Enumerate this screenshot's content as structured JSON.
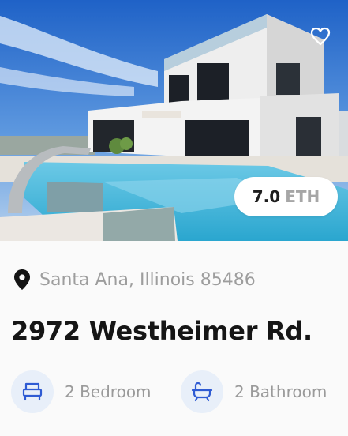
{
  "listing": {
    "price_amount": "7.0",
    "price_currency": "ETH",
    "location": "Santa Ana, Illinois 85486",
    "title": "2972 Westheimer Rd.",
    "bedrooms_label": "2 Bedroom",
    "bathrooms_label": "2 Bathroom"
  },
  "icons": {
    "favorite": "heart-outline-icon",
    "location": "map-pin-icon",
    "bedroom": "bed-icon",
    "bathroom": "bathtub-icon"
  },
  "colors": {
    "icon_accent": "#2f5bd3",
    "icon_bg": "#e8eff9",
    "muted_text": "#9d9d9d",
    "title_text": "#151515"
  }
}
